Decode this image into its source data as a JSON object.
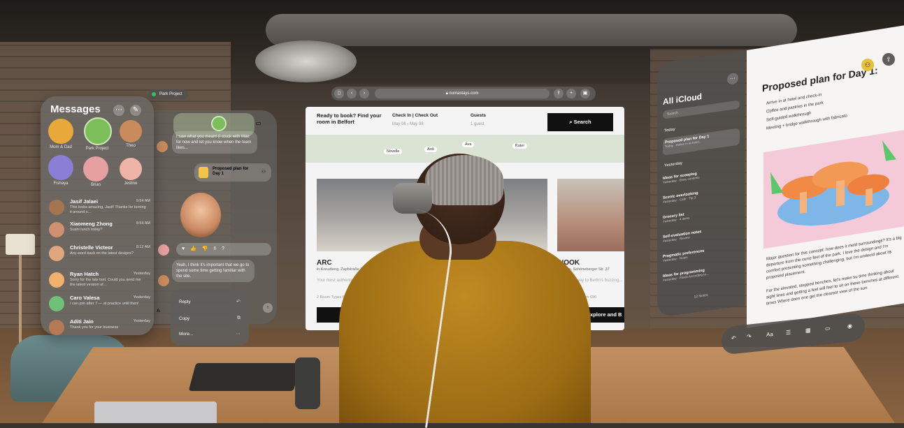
{
  "messages": {
    "title": "Messages",
    "pinned": [
      {
        "name": "Mom & Dad",
        "color": "#e9a93a"
      },
      {
        "name": "Park Project",
        "color": "#7cbf5a"
      },
      {
        "name": "Theo",
        "color": "#c98b5c"
      },
      {
        "name": "Fishaya",
        "color": "#8a7fd6"
      },
      {
        "name": "Brian",
        "color": "#e7a0a0"
      },
      {
        "name": "Jesline",
        "color": "#f0b3a8"
      }
    ],
    "conversations": [
      {
        "name": "Jasif Jalaei",
        "time": "9:54 AM",
        "preview": "This looks amazing, Jasif! Thanks for turning it around s..."
      },
      {
        "name": "Xiaomeng Zhong",
        "time": "8:54 AM",
        "preview": "Sushi lunch today?"
      },
      {
        "name": "Christelle Victeor",
        "time": "8:12 AM",
        "preview": "Any word back on the latest designs?"
      },
      {
        "name": "Ryan Hatch",
        "time": "Yesterday",
        "preview": "Sorry for the late text. Could you send me the latest version of..."
      },
      {
        "name": "Caro Valesa",
        "time": "Yesterday",
        "preview": "I can join after 7 — at practice until then!"
      },
      {
        "name": "Aditi Jain",
        "time": "Yesterday",
        "preview": "Thank you for your business"
      }
    ]
  },
  "thread": {
    "pill": "Park Project",
    "bubble1": "I saw what you meant (I stuck with Mae for now and let you know when the team likes...",
    "attachment_title": "Proposed plan for Day 1",
    "bubble2": "Yeah, I think it's important that we go to spend some time getting familiar with the site.",
    "menu": [
      {
        "label": "Reply",
        "icon": "↶"
      },
      {
        "label": "Copy",
        "icon": "⧉"
      },
      {
        "label": "More...",
        "icon": "⋯"
      }
    ]
  },
  "safari": {
    "url": "numastays.com",
    "ready_text": "Ready to book? Find your room in Belfort",
    "checkin_label": "Check In | Check Out",
    "checkin_value": "May 06 - May 08",
    "guests_label": "Guests",
    "guests_value": "1 guest",
    "search_label": "Search",
    "map_labels": [
      "Novelle",
      "Ardi",
      "Ava",
      "Kater"
    ],
    "cards": [
      {
        "name": "ARC",
        "address": "in Kreuzberg, Zapfstraße 31",
        "desc": "Your most authentic rest stay...",
        "types": "2 Room Types from",
        "button": "Explore and B"
      },
      {
        "name": "NOOK",
        "address": "in Mitte, Schöneberger Str. 37",
        "desc": "Your gateway to Berlin's buzzing...",
        "types": "Room Types from €96",
        "button": "Explore and B"
      }
    ]
  },
  "notes": {
    "title": "All iCloud",
    "search_placeholder": "Search",
    "section_today": "Today",
    "section_yesterday": "Yesterday",
    "items": [
      {
        "title": "Proposed plan for Day 1",
        "detail": "Today · Active in at hotel..."
      },
      {
        "title": "Ideas for scooping",
        "detail": "Yesterday · Entry contents"
      },
      {
        "title": "Scenic overlooking",
        "detail": "Yesterday · Cafe · Tip 3"
      },
      {
        "title": "Grocery list",
        "detail": "Yesterday · 4 items"
      },
      {
        "title": "Self-evaluation notes",
        "detail": "Yesterday · Review"
      },
      {
        "title": "Pragmatic preferences",
        "detail": "Yesterday · Notes"
      },
      {
        "title": "Ideas for programming",
        "detail": "Yesterday · Flexib According to..."
      }
    ],
    "count": "12 Notes"
  },
  "note_doc": {
    "title": "Proposed plan for Day 1:",
    "bullets": [
      "Arrive in at hotel and check-in",
      "Coffee and pastries in the park",
      "Self-guided walkthrough",
      "Meeting + bridge walkthrough with fabricato"
    ],
    "para1": "Major question for this concept: how does it meld surroundings? It's a big departure from the curre feel of the park. I love the design and I'm comfort presenting something challenging, but I'm undecid about its proposed placement.",
    "para2": "For the elevated, stepped benches, let's make su time thinking about sight lines and getting a feel will feel to sit on these benches at different times Where does one get the clearest view of the sun"
  },
  "colors": {
    "glass": "#6e6c69",
    "search_button": "#111111",
    "accent_green": "#39c35d",
    "person_shirt": "#c08a22"
  }
}
